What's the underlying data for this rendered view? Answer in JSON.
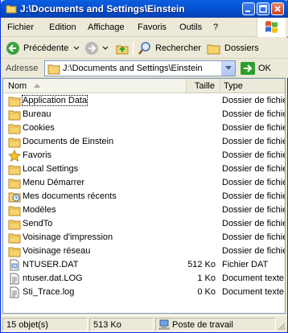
{
  "window": {
    "title": "J:\\Documents and Settings\\Einstein"
  },
  "menu": [
    "Fichier",
    "Edition",
    "Affichage",
    "Favoris",
    "Outils",
    "?"
  ],
  "toolbar": {
    "back_label": "Précédente",
    "search_label": "Rechercher",
    "folders_label": "Dossiers"
  },
  "address": {
    "label": "Adresse",
    "value": "J:\\Documents and Settings\\Einstein",
    "go_label": "OK"
  },
  "columns": {
    "name": "Nom",
    "size": "Taille",
    "type": "Type"
  },
  "files": [
    {
      "name": "Application Data",
      "size": "",
      "type": "Dossier de fichiers",
      "icon": "folder-icon"
    },
    {
      "name": "Bureau",
      "size": "",
      "type": "Dossier de fichiers",
      "icon": "folder-icon"
    },
    {
      "name": "Cookies",
      "size": "",
      "type": "Dossier de fichiers",
      "icon": "folder-icon"
    },
    {
      "name": "Documents de Einstein",
      "size": "",
      "type": "Dossier de fichiers",
      "icon": "folder-icon"
    },
    {
      "name": "Favoris",
      "size": "",
      "type": "Dossier de fichiers",
      "icon": "star-folder-icon"
    },
    {
      "name": "Local Settings",
      "size": "",
      "type": "Dossier de fichiers",
      "icon": "folder-icon"
    },
    {
      "name": "Menu Démarrer",
      "size": "",
      "type": "Dossier de fichiers",
      "icon": "folder-icon"
    },
    {
      "name": "Mes documents récents",
      "size": "",
      "type": "Dossier de fichiers",
      "icon": "recent-docs-icon"
    },
    {
      "name": "Modèles",
      "size": "",
      "type": "Dossier de fichiers",
      "icon": "folder-icon"
    },
    {
      "name": "SendTo",
      "size": "",
      "type": "Dossier de fichiers",
      "icon": "folder-icon"
    },
    {
      "name": "Voisinage d'impression",
      "size": "",
      "type": "Dossier de fichiers",
      "icon": "folder-icon"
    },
    {
      "name": "Voisinage réseau",
      "size": "",
      "type": "Dossier de fichiers",
      "icon": "folder-icon"
    },
    {
      "name": "NTUSER.DAT",
      "size": "512 Ko",
      "type": "Fichier DAT",
      "icon": "dat-file-icon"
    },
    {
      "name": "ntuser.dat.LOG",
      "size": "1 Ko",
      "type": "Document texte",
      "icon": "text-file-icon"
    },
    {
      "name": "Sti_Trace.log",
      "size": "0 Ko",
      "type": "Document texte",
      "icon": "text-file-icon"
    }
  ],
  "status": {
    "count": "15 objet(s)",
    "size": "513 Ko",
    "location": "Poste de travail"
  },
  "colors": {
    "titlebar": "#0553D4",
    "chrome": "#ECE9D8",
    "folder": "#F6D36B"
  }
}
